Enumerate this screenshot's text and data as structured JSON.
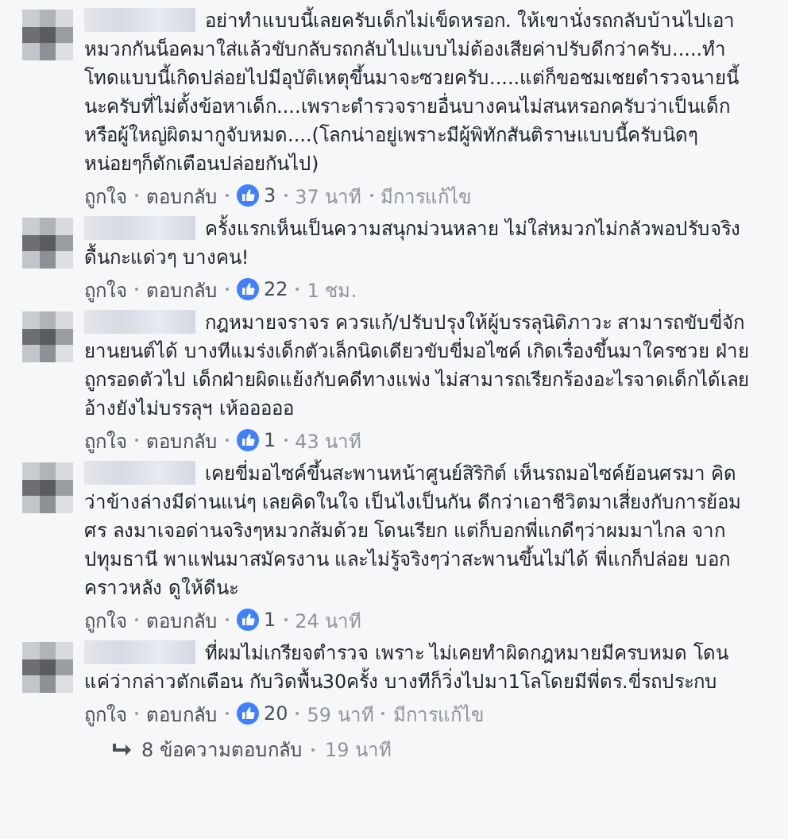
{
  "comments": [
    {
      "text": "อย่าทำแบบนี้เลยครับเด็กไม่เข็ดหรอก. ให้เขานั่งรถกลับบ้านไปเอาหมวกกันน็อคมาใส่แล้วขับกลับรถกลับไปแบบไม่ต้องเสียค่าปรับดีกว่าครับ.....ทำโทดแบบนี้เกิดปล่อยไปมีอุบัติเหตุขึ้นมาจะซวยครับ.....แต่ก็ขอชมเชยตำรวจนายนี้นะครับที่ไม่ตั้งข้อหาเด็ก....เพราะตำรวจรายอื่นบางคนไม่สนหรอกครับว่าเป็นเด็กหรือผู้ใหญ่ผิดมากูจับหมด....(โลกน่าอยู่เพราะมีผู้พิทักสันติราษแบบนี้ครับนิดๆหน่อยๆก็ตักเตือนปล่อยกันไป)",
      "like": "ถูกใจ",
      "reply": "ตอบกลับ",
      "likes": "3",
      "time": "37 นาที",
      "edited": "มีการแก้ไข"
    },
    {
      "text": "ครั้งแรกเห็นเป็นความสนุกม่วนหลาย ไม่ใส่หมวกไม่กลัวพอปรับจริงดื้นกะแด่วๆ บางคน!",
      "like": "ถูกใจ",
      "reply": "ตอบกลับ",
      "likes": "22",
      "time": "1 ชม."
    },
    {
      "text": "กฎหมายจราจร ควรแก้/ปรับปรุงให้ผู้บรรลุนิติภาวะ สามารถขับขี่จักยานยนต์ได้ บางทีแมร่งเด็กตัวเล็กนิดเดียวขับขี่มอไซค์ เกิดเรื่องขึ้นมาใครชวย ฝ่ายถูกรอดตัวไป เด็กฝ่ายผิดแย้งกับคดีทางแพ่ง ไม่สามารถเรียกร้องอะไรจาดเด็กได้เลย อ้างยังไม่บรรลุฯ เห้อออออ",
      "like": "ถูกใจ",
      "reply": "ตอบกลับ",
      "likes": "1",
      "time": "43 นาที"
    },
    {
      "text": "เคยขี่มอไซค์ขึ้นสะพานหน้าศูนย์สิริกิต์ เห็นรถมอไซค์ย้อนศรมา คิดว่าข้างล่างมีด่านแน่ๆ เลยคิดในใจ เป็นไงเป็นกัน ดีกว่าเอาชีวิตมาเสี่ยงกับการย้อมศร ลงมาเจอด่านจริงๆหมวกส้มด้วย โดนเรียก แต่ก็บอกพี่แกดีๆว่าผมมาไกล จากปทุมธานี พาแฟนมาสมัครงาน และไม่รู้จริงๆว่าสะพานขึ้นไม่ได้ พี่แกก็ปล่อย บอกคราวหลัง ดูให้ดีนะ",
      "like": "ถูกใจ",
      "reply": "ตอบกลับ",
      "likes": "1",
      "time": "24 นาที"
    },
    {
      "text": "ที่ผมไม่เกรียจตำรวจ เพราะ ไม่เคยทำผิดกฎหมายมีครบหมด โดนแค่ว่ากล่าวตักเตือน กับวิดพื้น30ครั้ง บางทีก็วิ่งไปมา1โลโดยมีพี่ตร.ขี่รถประกบ",
      "like": "ถูกใจ",
      "reply": "ตอบกลับ",
      "likes": "20",
      "time": "59 นาที",
      "edited": "มีการแก้ไข"
    }
  ],
  "replies": {
    "label": "8 ข้อความตอบกลับ",
    "time": "19 นาที"
  }
}
